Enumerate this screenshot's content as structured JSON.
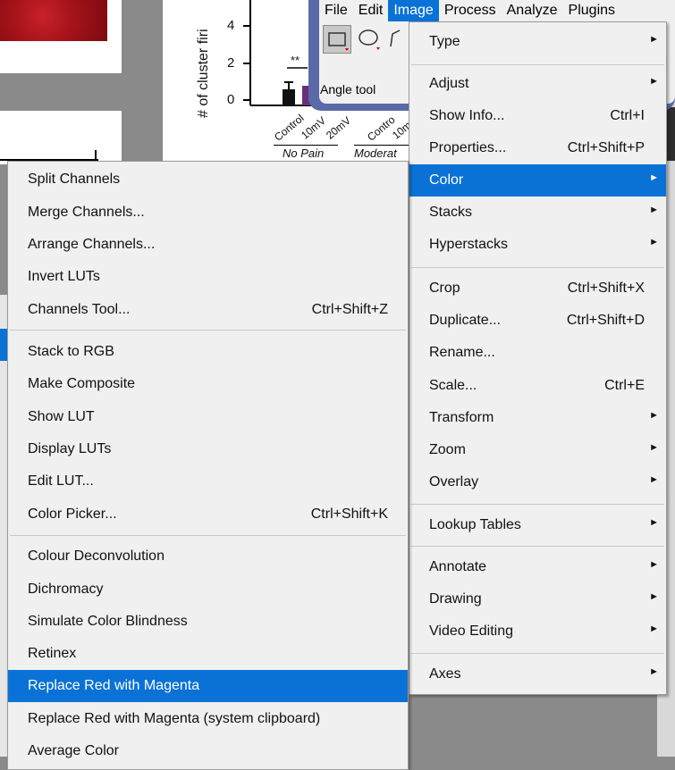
{
  "background_chart": {
    "ylabel": "# of cluster firi",
    "yticks": [
      "4",
      "2",
      "0"
    ],
    "significance": "**",
    "x_categories": [
      "Control",
      "10mV",
      "20mV",
      "Contro",
      "10m"
    ],
    "groups": [
      "No Pain",
      "Moderat"
    ]
  },
  "chart_data": {
    "type": "bar",
    "ylabel": "# of cluster firi",
    "yticks": [
      "0",
      "2",
      "4"
    ],
    "categories": [
      "Control",
      "10mV",
      "20mV",
      "Contro",
      "10m"
    ],
    "groups": [
      "No Pain",
      "Moderat"
    ],
    "annotations": [
      "**"
    ]
  },
  "imagej": {
    "menubar": [
      "File",
      "Edit",
      "Image",
      "Process",
      "Analyze",
      "Plugins"
    ],
    "active_menu": "Image",
    "status": "Angle tool"
  },
  "image_menu": {
    "items": [
      {
        "label": "Type",
        "submenu": true
      },
      {
        "label": "Adjust",
        "submenu": true
      },
      {
        "label": "Show Info...",
        "shortcut": "Ctrl+I"
      },
      {
        "label": "Properties...",
        "shortcut": "Ctrl+Shift+P"
      },
      {
        "label": "Color",
        "submenu": true,
        "highlighted": true
      },
      {
        "label": "Stacks",
        "submenu": true
      },
      {
        "label": "Hyperstacks",
        "submenu": true
      },
      {
        "label": "Crop",
        "shortcut": "Ctrl+Shift+X"
      },
      {
        "label": "Duplicate...",
        "shortcut": "Ctrl+Shift+D"
      },
      {
        "label": "Rename..."
      },
      {
        "label": "Scale...",
        "shortcut": "Ctrl+E"
      },
      {
        "label": "Transform",
        "submenu": true
      },
      {
        "label": "Zoom",
        "submenu": true
      },
      {
        "label": "Overlay",
        "submenu": true
      },
      {
        "label": "Lookup Tables",
        "submenu": true
      },
      {
        "label": "Annotate",
        "submenu": true
      },
      {
        "label": "Drawing",
        "submenu": true
      },
      {
        "label": "Video Editing",
        "submenu": true
      },
      {
        "label": "Axes",
        "submenu": true
      }
    ]
  },
  "color_menu": {
    "items": [
      {
        "label": "Split Channels"
      },
      {
        "label": "Merge Channels..."
      },
      {
        "label": "Arrange Channels..."
      },
      {
        "label": "Invert LUTs"
      },
      {
        "label": "Channels Tool...",
        "shortcut": "Ctrl+Shift+Z"
      },
      {
        "label": "Stack to RGB"
      },
      {
        "label": "Make Composite"
      },
      {
        "label": "Show LUT"
      },
      {
        "label": "Display LUTs"
      },
      {
        "label": "Edit LUT..."
      },
      {
        "label": "Color Picker...",
        "shortcut": "Ctrl+Shift+K"
      },
      {
        "label": "Colour Deconvolution"
      },
      {
        "label": "Dichromacy"
      },
      {
        "label": "Simulate Color Blindness"
      },
      {
        "label": "Retinex"
      },
      {
        "label": "Replace Red with Magenta",
        "highlighted": true
      },
      {
        "label": "Replace Red with Magenta (system clipboard)"
      },
      {
        "label": "Average Color"
      }
    ]
  },
  "colors": {
    "highlight": "#0a72d6",
    "menu_bg": "#f0f0f0",
    "imagej_frame": "#5a6aa8"
  }
}
